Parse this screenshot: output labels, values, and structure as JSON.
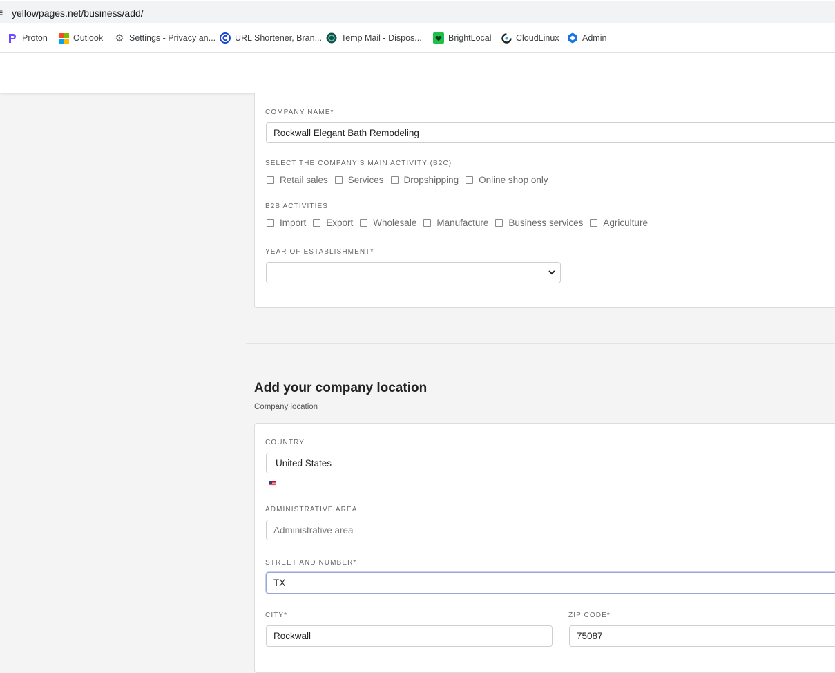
{
  "browser": {
    "url": "yellowpages.net/business/add/",
    "bookmarks": [
      {
        "label": "Proton",
        "icon": "proton-icon"
      },
      {
        "label": "Outlook",
        "icon": "microsoft-icon"
      },
      {
        "label": "Settings - Privacy an...",
        "icon": "gear-icon"
      },
      {
        "label": "URL Shortener, Bran...",
        "icon": "url-shortener-icon"
      },
      {
        "label": "Temp Mail - Dispos...",
        "icon": "temp-mail-icon"
      },
      {
        "label": "BrightLocal",
        "icon": "brightlocal-icon"
      },
      {
        "label": "CloudLinux",
        "icon": "cloudlinux-icon"
      },
      {
        "label": "Admin",
        "icon": "admin-hexagon-icon"
      }
    ]
  },
  "company": {
    "name_label": "COMPANY NAME*",
    "name_value": "Rockwall Elegant Bath Remodeling",
    "b2c_label": "SELECT THE COMPANY'S MAIN ACTIVITY (B2C)",
    "b2c_options": [
      "Retail sales",
      "Services",
      "Dropshipping",
      "Online shop only"
    ],
    "b2b_label": "B2B ACTIVITIES",
    "b2b_options": [
      "Import",
      "Export",
      "Wholesale",
      "Manufacture",
      "Business services",
      "Agriculture"
    ],
    "year_label": "YEAR OF ESTABLISHMENT*",
    "year_value": ""
  },
  "location": {
    "title": "Add your company location",
    "subtitle": "Company location",
    "country_label": "COUNTRY",
    "country_value": "United States",
    "admin_label": "ADMINISTRATIVE AREA",
    "admin_placeholder": "Administrative area",
    "street_label": "STREET AND NUMBER*",
    "street_value": "TX",
    "city_label": "CITY*",
    "city_value": "Rockwall",
    "zip_label": "ZIP CODE*",
    "zip_value": "75087"
  },
  "colors": {
    "page_bg": "#f4f4f4",
    "focus_border": "#9aa6d8",
    "proton": "#6d4aff",
    "admin": "#1a73e8"
  }
}
